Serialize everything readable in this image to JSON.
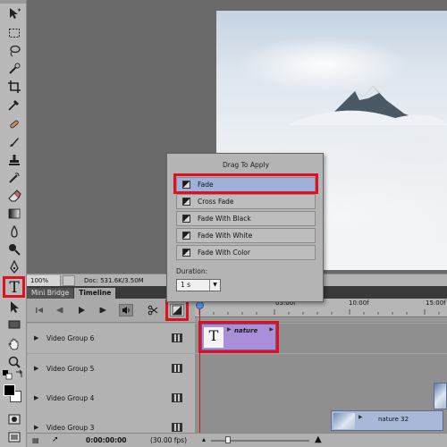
{
  "status_bar": {
    "zoom": "100%",
    "doc_info": "Doc: 531.6K/3.50M"
  },
  "panel_tabs": [
    {
      "label": "Mini Bridge"
    },
    {
      "label": "Timeline"
    }
  ],
  "timeline": {
    "ruler_labels": [
      "05:00f",
      "10:00f",
      "15:00f"
    ],
    "tracks": [
      {
        "name": "Video Group 6"
      },
      {
        "name": "Video Group 5"
      },
      {
        "name": "Video Group 4"
      },
      {
        "name": "Video Group 3"
      }
    ],
    "text_clip_name": "nature",
    "text_clip_glyph": "T",
    "media_clip_name": "nature 32",
    "timecode": "0:00:00:00",
    "fps": "(30.00 fps)"
  },
  "transition_popup": {
    "title": "Drag To Apply",
    "items": [
      {
        "label": "Fade"
      },
      {
        "label": "Cross Fade"
      },
      {
        "label": "Fade With Black"
      },
      {
        "label": "Fade With White"
      },
      {
        "label": "Fade With Color"
      }
    ],
    "selected": "Fade",
    "duration_label": "Duration:",
    "duration_value": "1 s"
  },
  "tools": {
    "text_tool_glyph": "T"
  },
  "colors": {
    "highlight": "#e01020",
    "text_clip": "#a98fd8",
    "media_clip": "#a9b8d8",
    "playhead": "#d21414"
  }
}
